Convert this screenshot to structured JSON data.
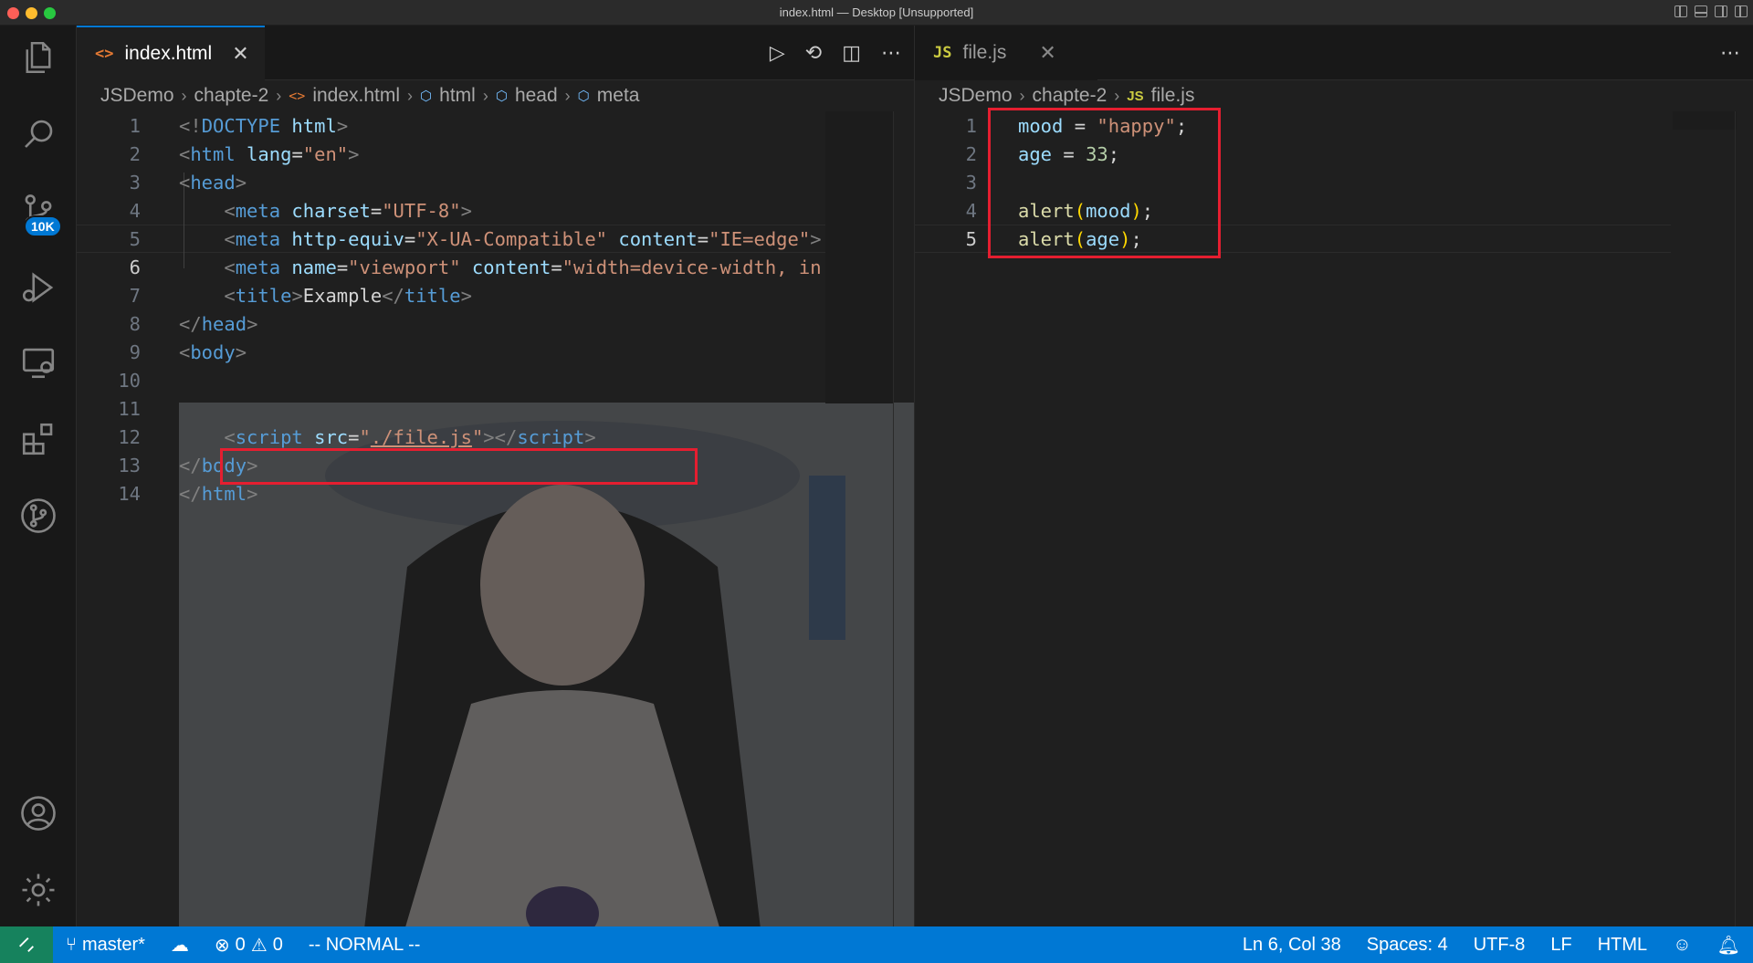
{
  "window": {
    "title": "index.html — Desktop [Unsupported]"
  },
  "activity_bar": {
    "source_control_badge": "10K"
  },
  "left_editor": {
    "tab": {
      "label": "index.html",
      "icon_glyph": "<>"
    },
    "breadcrumb": [
      "JSDemo",
      "chapte-2",
      "index.html",
      "html",
      "head",
      "meta"
    ],
    "lines": [
      {
        "n": "1"
      },
      {
        "n": "2"
      },
      {
        "n": "3"
      },
      {
        "n": "4"
      },
      {
        "n": "5"
      },
      {
        "n": "6"
      },
      {
        "n": "7"
      },
      {
        "n": "8"
      },
      {
        "n": "9"
      },
      {
        "n": "10"
      },
      {
        "n": "11"
      },
      {
        "n": "12"
      },
      {
        "n": "13"
      },
      {
        "n": "14"
      }
    ],
    "code": {
      "l1_a": "<!",
      "l1_b": "DOCTYPE",
      "l1_c": " html",
      "l1_d": ">",
      "l2_tag": "html",
      "l2_attr": " lang",
      "l2_eq": "=",
      "l2_val": "\"en\"",
      "l3_tag": "head",
      "l4_tag": "meta",
      "l4_attr": " charset",
      "l4_val": "\"UTF-8\"",
      "l5_tag": "meta",
      "l5_attr1": " http-equiv",
      "l5_val1": "\"X-UA-Compatible\"",
      "l5_attr2": " content",
      "l5_val2": "\"IE=edge\"",
      "l6_tag": "meta",
      "l6_attr1": " name",
      "l6_val1": "\"viewport\"",
      "l6_attr2": " content",
      "l6_val2": "\"width=device-width, in",
      "l7_tag": "title",
      "l7_text": "Example",
      "l7_close": "title",
      "l8_tag": "head",
      "l9_tag": "body",
      "l12_tag": "script",
      "l12_attr": " src",
      "l12_val_q1": "\"",
      "l12_val": "./file.js",
      "l12_val_q2": "\"",
      "l12_close": "script",
      "l13_tag": "body",
      "l14_tag": "html"
    },
    "current_line": "6"
  },
  "right_editor": {
    "tab": {
      "label": "file.js",
      "icon_glyph": "JS"
    },
    "breadcrumb": [
      "JSDemo",
      "chapte-2",
      "file.js"
    ],
    "lines": [
      {
        "n": "1"
      },
      {
        "n": "2"
      },
      {
        "n": "3"
      },
      {
        "n": "4"
      },
      {
        "n": "5"
      }
    ],
    "code": {
      "l1_var": "mood",
      "l1_op": " = ",
      "l1_str": "\"happy\"",
      "l1_semi": ";",
      "l2_var": "age",
      "l2_op": " = ",
      "l2_num": "33",
      "l2_semi": ";",
      "l4_fn": "alert",
      "l4_arg": "mood",
      "l4_semi": ";",
      "l5_fn": "alert",
      "l5_arg": "age",
      "l5_semi": ";"
    }
  },
  "status_bar": {
    "branch": "master*",
    "errors": "0",
    "warnings": "0",
    "vim_mode": "-- NORMAL --",
    "cursor": "Ln 6, Col 38",
    "spaces": "Spaces: 4",
    "encoding": "UTF-8",
    "eol": "LF",
    "language": "HTML"
  },
  "colors": {
    "accent": "#0078d4",
    "highlight_box": "#e51e30",
    "remote_indicator": "#16825d"
  }
}
